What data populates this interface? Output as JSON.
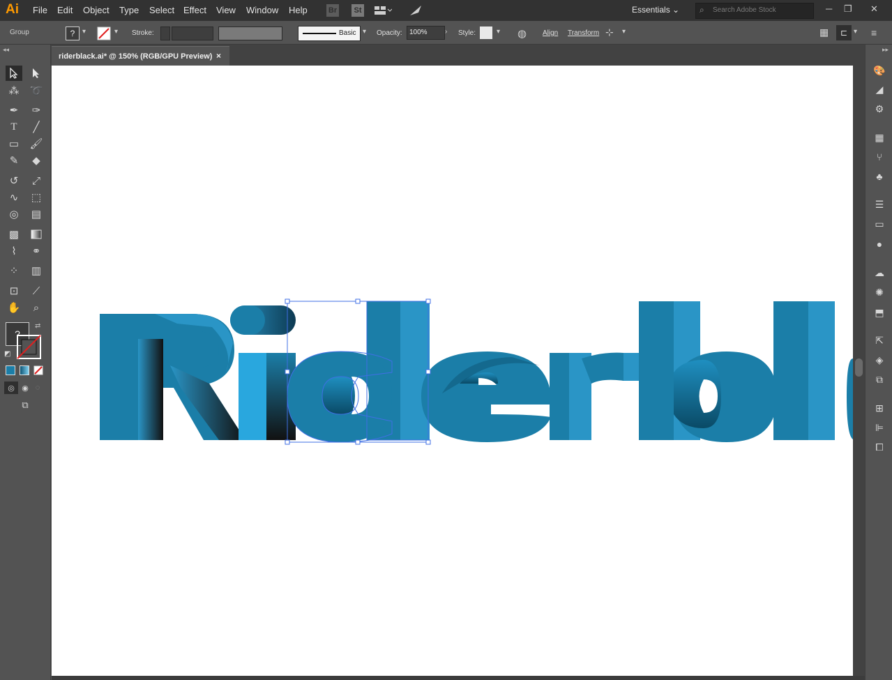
{
  "app": {
    "logo": "Ai"
  },
  "menu": [
    "File",
    "Edit",
    "Object",
    "Type",
    "Select",
    "Effect",
    "View",
    "Window",
    "Help"
  ],
  "menubar": {
    "bridge": "Br",
    "stock": "St",
    "workspace": "Essentials",
    "search_placeholder": "Search Adobe Stock"
  },
  "control": {
    "selection_type": "Group",
    "fill_unknown": "?",
    "stroke_label": "Stroke:",
    "brush_label": "Basic",
    "opacity_label": "Opacity:",
    "opacity_value": "100%",
    "style_label": "Style:",
    "align_label": "Align",
    "transform_label": "Transform"
  },
  "document": {
    "tab_title": "riderblack.ai* @ 150% (RGB/GPU Preview)",
    "close": "×"
  },
  "toolbar": {
    "fill_unknown": "?"
  },
  "artwork": {
    "colors": {
      "base": "#1b7ea8",
      "light": "#2a95c6",
      "dark": "#0e5474",
      "shadow": "#111111",
      "selection": "#3f6fe4"
    }
  },
  "icons": {
    "selection": "selection-tool-icon",
    "direct_selection": "direct-selection-tool-icon",
    "pen": "pen-tool-icon",
    "type": "type-tool-icon",
    "hand": "hand-tool-icon",
    "zoom": "zoom-tool-icon"
  }
}
